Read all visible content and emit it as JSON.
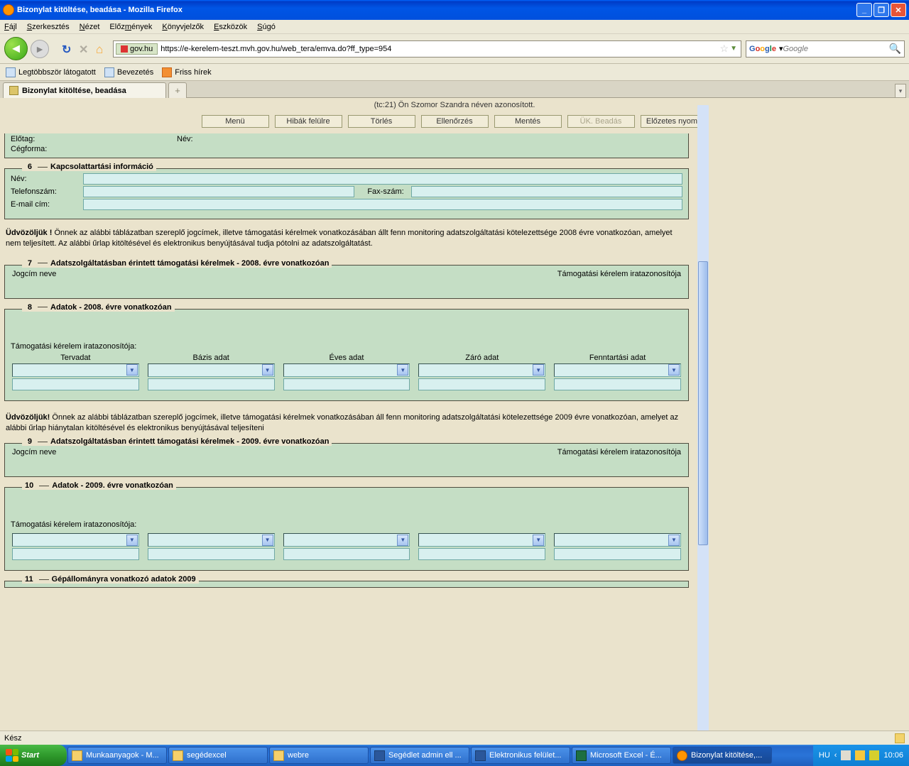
{
  "titlebar": {
    "text": "Bizonylat kitöltése, beadása - Mozilla Firefox"
  },
  "menubar": {
    "file": "Fájl",
    "edit": "Szerkesztés",
    "view": "Nézet",
    "history": "Előzmények",
    "bookmarks": "Könyvjelzők",
    "tools": "Eszközök",
    "help": "Súgó"
  },
  "urlbar": {
    "identity": "gov.hu",
    "url": "https://e-kerelem-teszt.mvh.gov.hu/web_tera/emva.do?ff_type=954"
  },
  "searchbar": {
    "placeholder": "Google"
  },
  "bookmarks": {
    "most": "Legtöbbször látogatott",
    "intro": "Bevezetés",
    "news": "Friss hírek"
  },
  "tab": {
    "title": "Bizonylat kitöltése, beadása"
  },
  "page": {
    "authline": "(tc:21) Ön Szomor Szandra néven azonosított.",
    "buttons": {
      "menu": "Menü",
      "errors": "Hibák felülre",
      "delete": "Törlés",
      "check": "Ellenőrzés",
      "save": "Mentés",
      "submit": "ÜK. Beadás",
      "preview": "Előzetes nyomt."
    },
    "top": {
      "elotag": "Előtag:",
      "nev": "Név:",
      "cegforma": "Cégforma:"
    },
    "section6": {
      "num": "6",
      "title": "Kapcsolattartási információ",
      "name": "Név:",
      "phone": "Telefonszám:",
      "fax": "Fax-szám:",
      "email": "E-mail cím:"
    },
    "para1": "Üdvözöljük ! Önnek az alábbi táblázatban szereplő jogcímek, illetve támogatási kérelmek vonatkozásában állt fenn monitoring adatszolgáltatási kötelezettsége 2008 évre vonatkozóan, amelyet nem teljesített. Az alábbi űrlap kitöltésével és elektronikus benyújtásával tudja pótolni az adatszolgáltatást.",
    "section7": {
      "num": "7",
      "title": "Adatszolgáltatásban érintett támogatási kérelmek - 2008. évre vonatkozóan",
      "left": "Jogcím neve",
      "right": "Támogatási kérelem iratazonosítója"
    },
    "section8": {
      "num": "8",
      "title": "Adatok - 2008. évre vonatkozóan",
      "subtext": "Támogatási kérelem iratazonosítója:",
      "cols": {
        "c1": "Tervadat",
        "c2": "Bázis adat",
        "c3": "Éves adat",
        "c4": "Záró adat",
        "c5": "Fenntartási adat"
      }
    },
    "para2": "Üdvözöljük! Önnek az alábbi táblázatban szereplő jogcímek, illetve támogatási kérelmek vonatkozásában áll fenn monitoring adatszolgáltatási kötelezettsége 2009 évre vonatkozóan, amelyet az alábbi űrlap hiánytalan kitöltésével és elektronikus benyújtásával teljesíteni",
    "section9": {
      "num": "9",
      "title": "Adatszolgáltatásban érintett támogatási kérelmek - 2009. évre vonatkozóan",
      "left": "Jogcím neve",
      "right": "Támogatási kérelem iratazonosítója"
    },
    "section10": {
      "num": "10",
      "title": "Adatok - 2009. évre vonatkozóan",
      "subtext": "Támogatási kérelem iratazonosítója:"
    },
    "section11": {
      "num": "11",
      "title": "Gépállományra vonatkozó adatok 2009"
    }
  },
  "statusbar": {
    "ready": "Kész"
  },
  "taskbar": {
    "start": "Start",
    "items": {
      "t1": "Munkaanyagok - M...",
      "t2": "segédexcel",
      "t3": "webre",
      "t4": "Segédlet admin ell ...",
      "t5": "Elektronikus felület...",
      "t6": "Microsoft Excel - É...",
      "t7": "Bizonylat kitöltése,..."
    },
    "tray": {
      "lang": "HU",
      "time": "10:06"
    }
  }
}
